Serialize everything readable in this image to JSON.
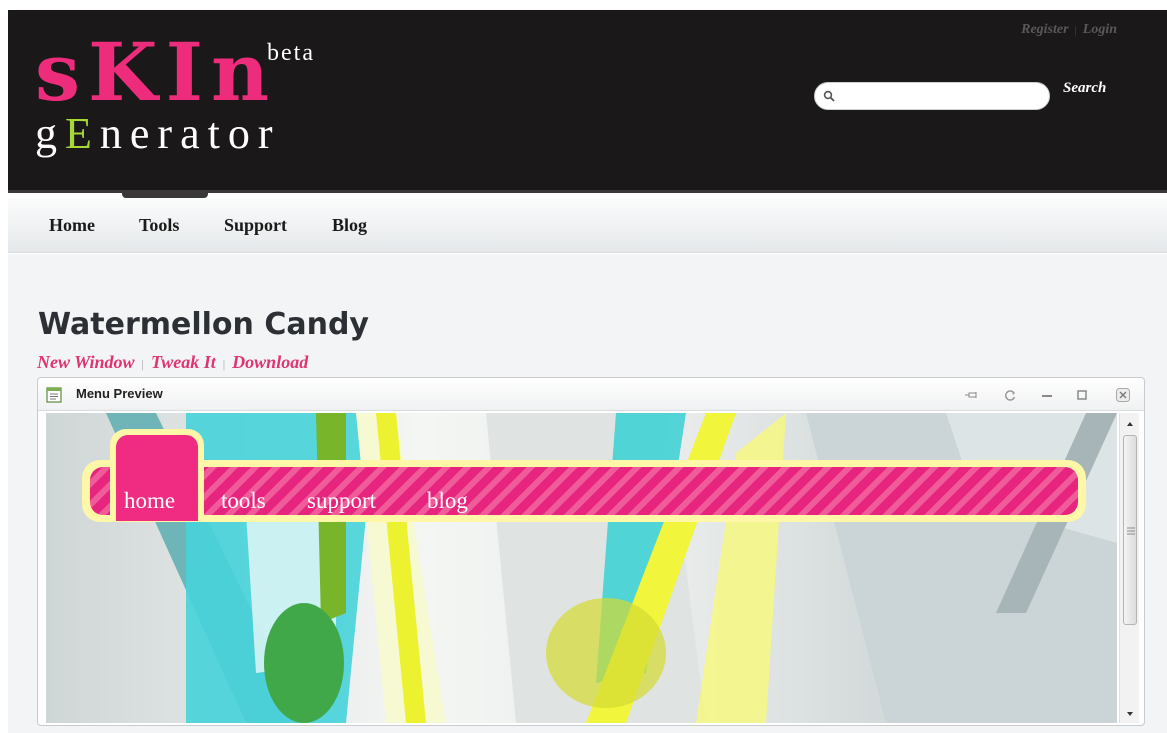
{
  "header": {
    "logo": {
      "word1": "sKIn",
      "beta": "beta",
      "word2_g": "g",
      "word2_E": "E",
      "word2_rest": "nerator"
    },
    "auth": {
      "register": "Register",
      "separator": "|",
      "login": "Login"
    },
    "search": {
      "placeholder": "",
      "button_label": "Search"
    }
  },
  "nav": {
    "items": [
      "Home",
      "Tools",
      "Support",
      "Blog"
    ]
  },
  "page": {
    "title": "Watermellon Candy",
    "actions": {
      "new_window": "New Window",
      "tweak_it": "Tweak It",
      "download": "Download",
      "separator": "|"
    }
  },
  "panel": {
    "title": "Menu Preview",
    "preview_menu": {
      "items": [
        "home",
        "tools",
        "support",
        "blog"
      ],
      "active": "home"
    }
  },
  "colors": {
    "brand_pink": "#ee2c7c",
    "brand_lime": "#a8d838",
    "header_bg": "#1a1818",
    "menu_yellow": "#fff7a8"
  }
}
